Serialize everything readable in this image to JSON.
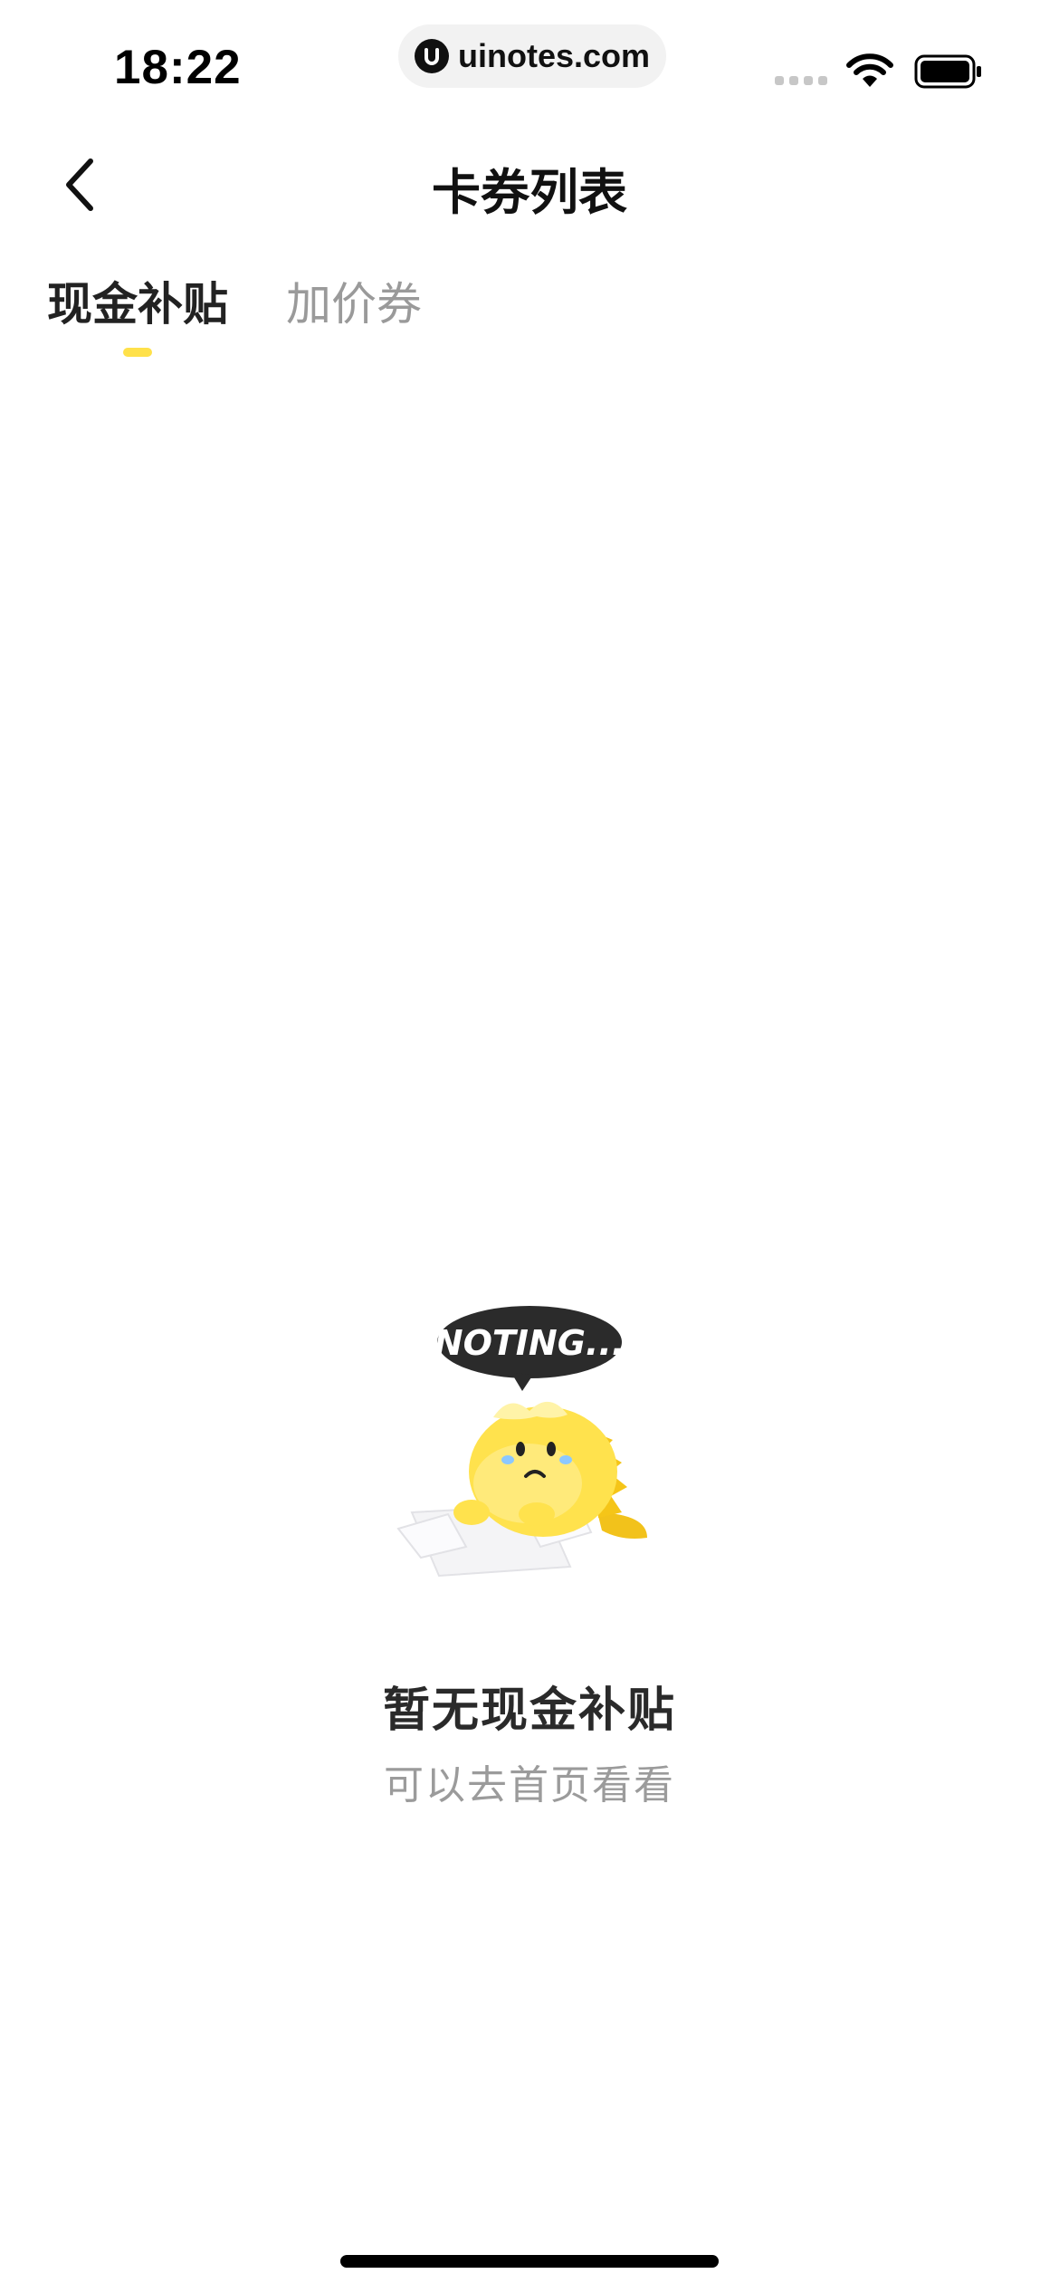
{
  "status_bar": {
    "time": "18:22",
    "url": "uinotes.com",
    "icons": [
      "cellular-signal-icon",
      "wifi-icon",
      "battery-icon"
    ]
  },
  "nav": {
    "title": "卡券列表",
    "back_icon": "chevron-left-icon"
  },
  "tabs": [
    {
      "label": "现金补贴",
      "active": true
    },
    {
      "label": "加价券",
      "active": false
    }
  ],
  "empty_state": {
    "bubble_text": "NOTING...",
    "title": "暂无现金补贴",
    "subtitle": "可以去首页看看"
  },
  "colors": {
    "accent": "#ffe14a",
    "text_primary": "#222222",
    "text_secondary": "#9b9b9b",
    "background": "#ffffff"
  }
}
